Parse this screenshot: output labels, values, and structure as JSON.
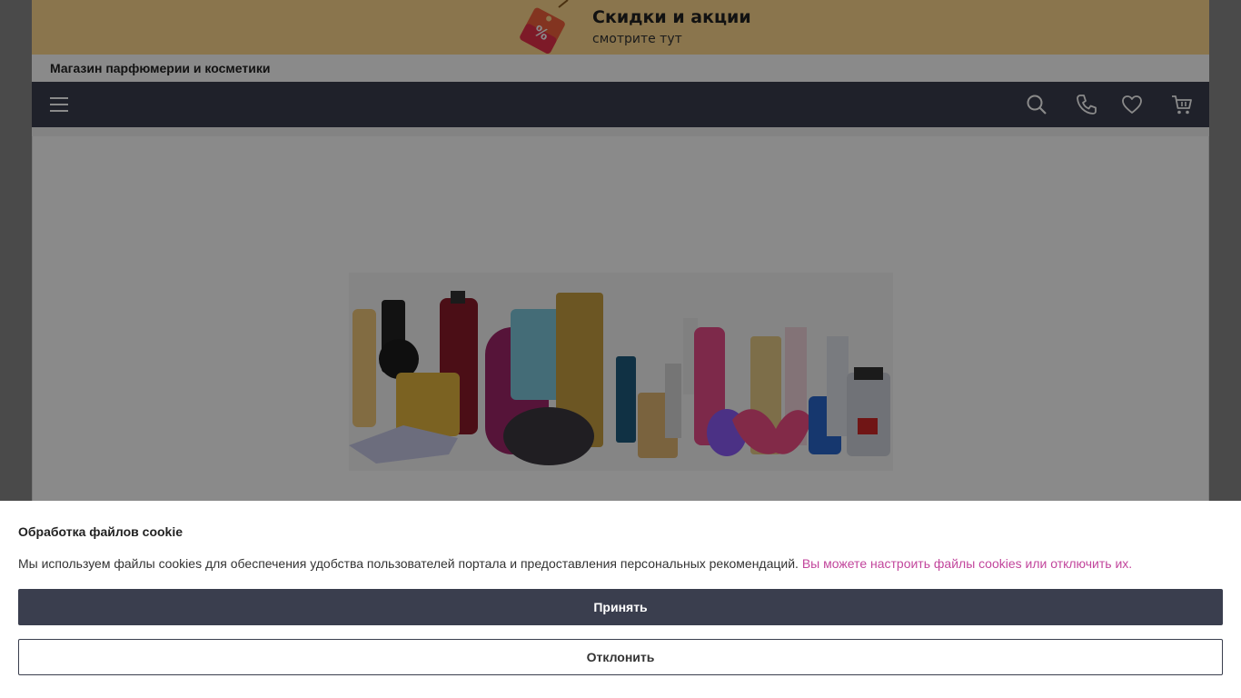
{
  "promo": {
    "icon": "discount-tag-icon",
    "title": "Скидки и акции",
    "subtitle": "смотрите тут"
  },
  "header": {
    "store_name": "Магазин парфюмерии и косметики"
  },
  "navbar": {
    "icons": [
      "menu-icon",
      "search-icon",
      "phone-icon",
      "heart-icon",
      "cart-icon"
    ],
    "background": "#3a3e4e"
  },
  "hero": {
    "image": "perfume-bottles-banner"
  },
  "cookie": {
    "title": "Обработка файлов cookie",
    "text": "Мы используем файлы cookies для обеспечения удобства пользователей портала и предоставления персональных рекомендаций.",
    "link_text": "Вы можете настроить файлы cookies или отключить их.",
    "accept_label": "Принять",
    "decline_label": "Отклонить",
    "accent_color": "#c2469c"
  }
}
